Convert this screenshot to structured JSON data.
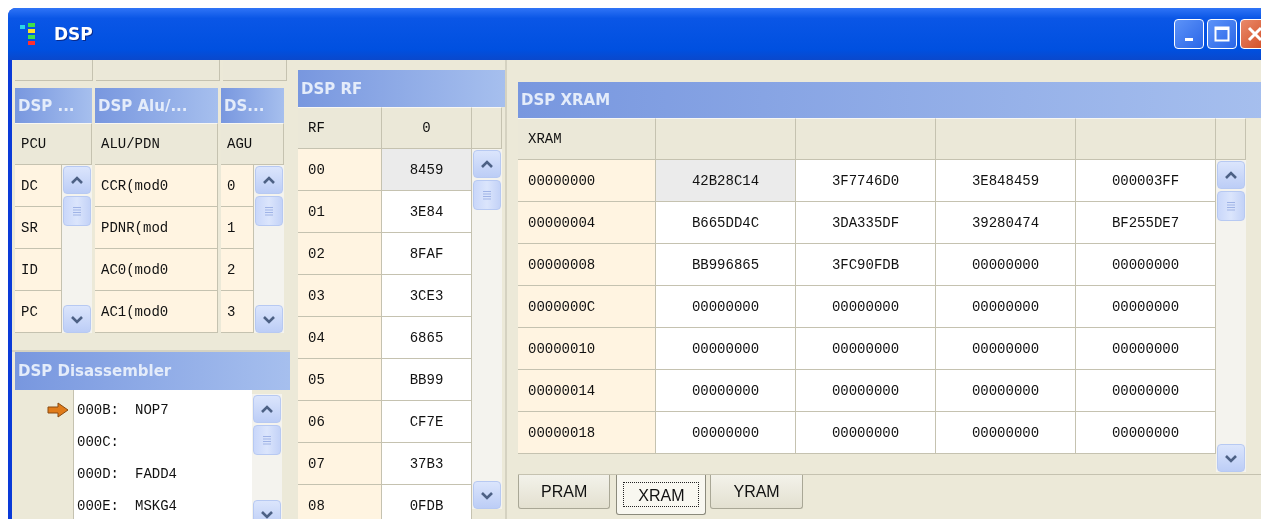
{
  "window": {
    "title": "DSP"
  },
  "register_panels": [
    {
      "title": "DSP ...",
      "column": "PCU",
      "rows": [
        "DC",
        "SR",
        "ID",
        "PC"
      ],
      "scrollbar": true
    },
    {
      "title": "DSP Alu/...",
      "column": "ALU/PDN",
      "rows": [
        "CCR(mod0",
        "PDNR(mod",
        "AC0(mod0",
        "AC1(mod0"
      ],
      "scrollbar": false
    },
    {
      "title": "DS...",
      "column": "AGU",
      "rows": [
        "0",
        "1",
        "2",
        "3"
      ],
      "scrollbar": true
    }
  ],
  "disassembler": {
    "title": "DSP Disassembler",
    "lines": [
      {
        "address": "000B:",
        "instruction": "NOP7",
        "current": true
      },
      {
        "address": "000C:",
        "current": false
      },
      {
        "address": "000D:",
        "instruction": "FADD4",
        "current": false
      },
      {
        "address": "000E:",
        "instruction": "MSKG4",
        "current": false
      }
    ]
  },
  "rf": {
    "title": "DSP RF",
    "columns": [
      "RF",
      "0"
    ],
    "rows": [
      {
        "address": "00",
        "cells": [
          {
            "text": "8459",
            "selected": true
          }
        ]
      },
      {
        "address": "01",
        "cells": [
          {
            "text": "3E84",
            "selected": false
          }
        ]
      },
      {
        "address": "02",
        "cells": [
          {
            "text": "8FAF",
            "selected": false
          }
        ]
      },
      {
        "address": "03",
        "cells": [
          {
            "text": "3CE3",
            "selected": false
          }
        ]
      },
      {
        "address": "04",
        "cells": [
          {
            "text": "6865",
            "selected": false
          }
        ]
      },
      {
        "address": "05",
        "cells": [
          {
            "text": "BB99",
            "selected": false
          }
        ]
      },
      {
        "address": "06",
        "cells": [
          {
            "text": "CF7E",
            "selected": false
          }
        ]
      },
      {
        "address": "07",
        "cells": [
          {
            "text": "37B3",
            "selected": false
          }
        ]
      },
      {
        "address": "08",
        "cells": [
          {
            "text": "0FDB",
            "selected": false
          }
        ]
      }
    ]
  },
  "xram": {
    "title": "DSP XRAM",
    "columns": [
      "XRAM"
    ],
    "rows": [
      {
        "address": "00000000",
        "cells": [
          {
            "text": "42B28C14",
            "selected": true
          },
          {
            "text": "3F7746D0",
            "selected": false
          },
          {
            "text": "3E848459",
            "selected": false
          },
          {
            "text": "000003FF",
            "selected": false
          }
        ]
      },
      {
        "address": "00000004",
        "cells": [
          {
            "text": "B665DD4C",
            "selected": false
          },
          {
            "text": "3DA335DF",
            "selected": false
          },
          {
            "text": "39280474",
            "selected": false
          },
          {
            "text": "BF255DE7",
            "selected": false
          }
        ]
      },
      {
        "address": "00000008",
        "cells": [
          {
            "text": "BB996865",
            "selected": false
          },
          {
            "text": "3FC90FDB",
            "selected": false
          },
          {
            "text": "00000000",
            "selected": false
          },
          {
            "text": "00000000",
            "selected": false
          }
        ]
      },
      {
        "address": "0000000C",
        "cells": [
          {
            "text": "00000000",
            "selected": false
          },
          {
            "text": "00000000",
            "selected": false
          },
          {
            "text": "00000000",
            "selected": false
          },
          {
            "text": "00000000",
            "selected": false
          }
        ]
      },
      {
        "address": "00000010",
        "cells": [
          {
            "text": "00000000",
            "selected": false
          },
          {
            "text": "00000000",
            "selected": false
          },
          {
            "text": "00000000",
            "selected": false
          },
          {
            "text": "00000000",
            "selected": false
          }
        ]
      },
      {
        "address": "00000014",
        "cells": [
          {
            "text": "00000000",
            "selected": false
          },
          {
            "text": "00000000",
            "selected": false
          },
          {
            "text": "00000000",
            "selected": false
          },
          {
            "text": "00000000",
            "selected": false
          }
        ]
      },
      {
        "address": "00000018",
        "cells": [
          {
            "text": "00000000",
            "selected": false
          },
          {
            "text": "00000000",
            "selected": false
          },
          {
            "text": "00000000",
            "selected": false
          },
          {
            "text": "00000000",
            "selected": false
          }
        ]
      }
    ],
    "tabs": [
      {
        "label": "PRAM",
        "selected": false
      },
      {
        "label": "XRAM",
        "selected": true
      },
      {
        "label": "YRAM",
        "selected": false
      }
    ]
  }
}
